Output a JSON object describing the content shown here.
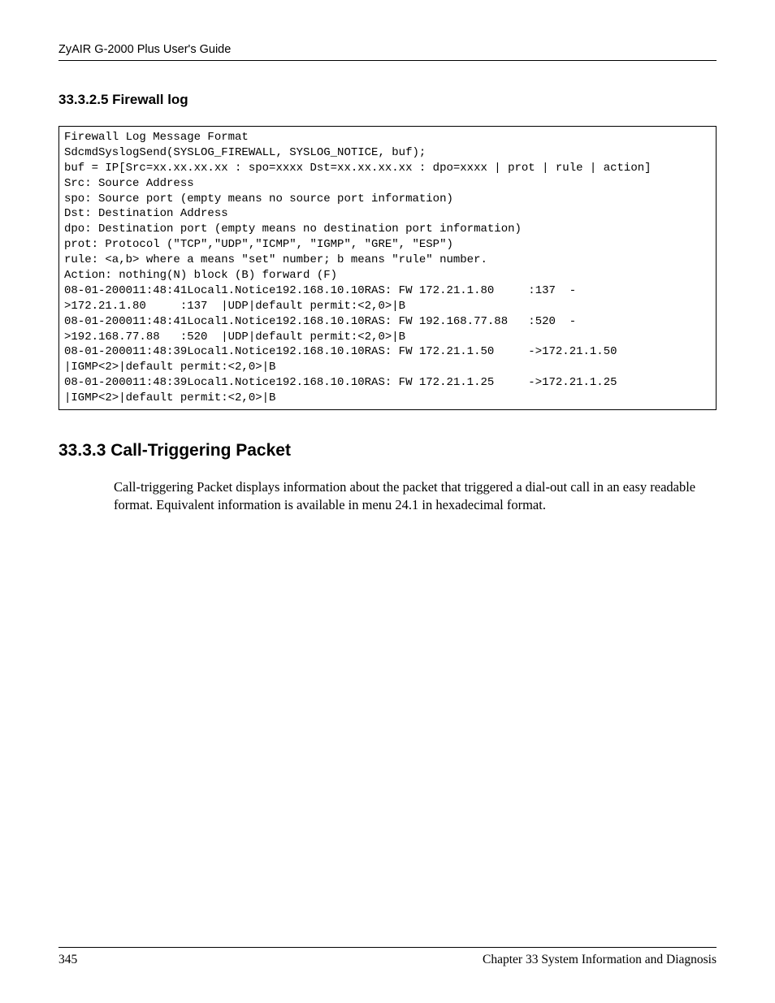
{
  "header": {
    "guide_title": "ZyAIR G-2000 Plus User's Guide"
  },
  "section1": {
    "number_title": "33.3.2.5  Firewall log"
  },
  "code": {
    "lines": [
      "Firewall Log Message Format ",
      "SdcmdSyslogSend(SYSLOG_FIREWALL, SYSLOG_NOTICE, buf);",
      "buf = IP[Src=xx.xx.xx.xx : spo=xxxx Dst=xx.xx.xx.xx : dpo=xxxx | prot | rule | action]",
      "Src: Source Address",
      "spo: Source port (empty means no source port information)",
      "Dst: Destination Address",
      "dpo: Destination port (empty means no destination port information)",
      "prot: Protocol (\"TCP\",\"UDP\",\"ICMP\", \"IGMP\", \"GRE\", \"ESP\")",
      "rule: <a,b> where a means \"set\" number; b means \"rule\" number.",
      "Action: nothing(N) block (B) forward (F)",
      "08-01-200011:48:41Local1.Notice192.168.10.10RAS: FW 172.21.1.80     :137  -",
      ">172.21.1.80     :137  |UDP|default permit:<2,0>|B",
      "08-01-200011:48:41Local1.Notice192.168.10.10RAS: FW 192.168.77.88   :520  -",
      ">192.168.77.88   :520  |UDP|default permit:<2,0>|B",
      "08-01-200011:48:39Local1.Notice192.168.10.10RAS: FW 172.21.1.50     ->172.21.1.50    ",
      "|IGMP<2>|default permit:<2,0>|B",
      "08-01-200011:48:39Local1.Notice192.168.10.10RAS: FW 172.21.1.25     ->172.21.1.25    ",
      "|IGMP<2>|default permit:<2,0>|B"
    ]
  },
  "section2": {
    "number_title": "33.3.3  Call-Triggering Packet",
    "paragraph": "Call-triggering Packet displays information about the packet that triggered a dial-out call in an easy readable format. Equivalent information is available in menu 24.1 in hexadecimal format."
  },
  "footer": {
    "page": "345",
    "chapter": "Chapter 33 System Information and Diagnosis"
  }
}
